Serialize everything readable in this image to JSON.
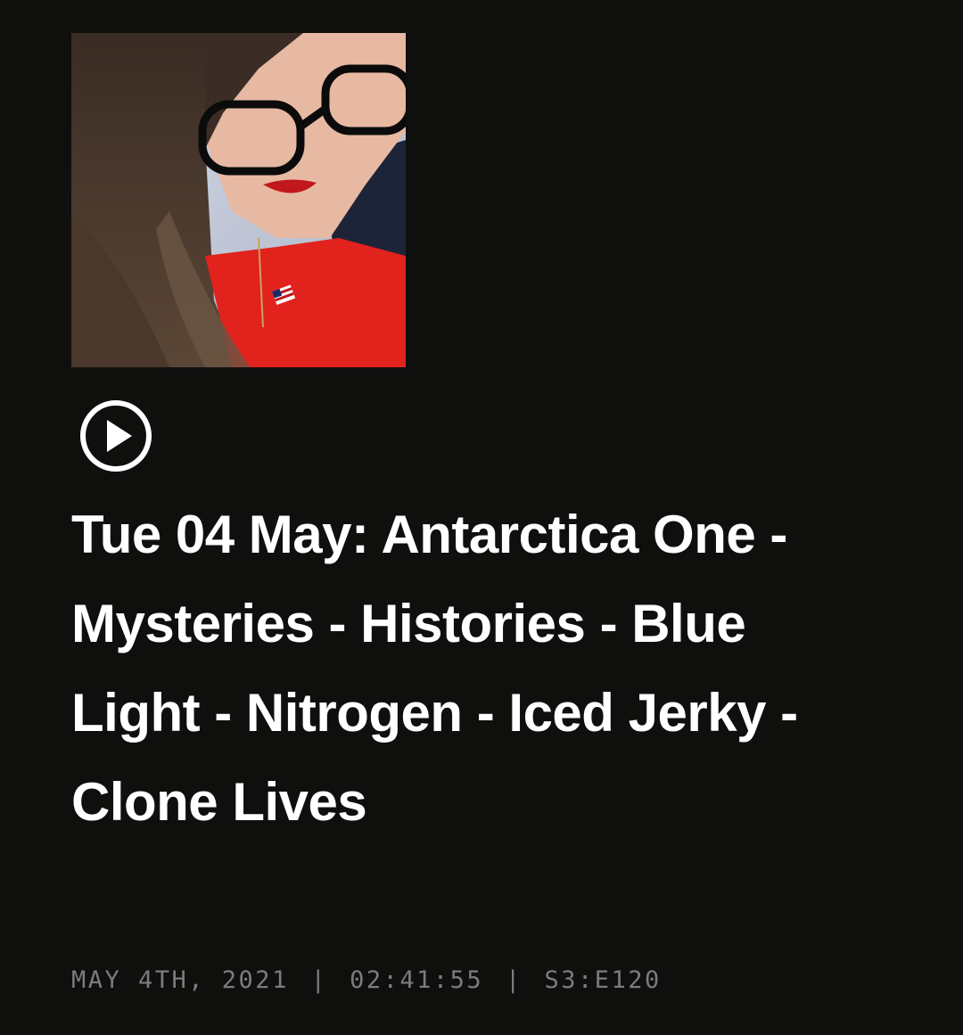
{
  "episode": {
    "cover_alt": "Podcast host portrait",
    "play_icon": "play-circle-icon",
    "title": "Tue 04 May: Antarctica One - Mysteries - Histories - Blue Light - Nitrogen - Iced Jerky - Clone Lives",
    "date": "MAY 4TH, 2021",
    "separator": "|",
    "duration": "02:41:55",
    "episode_code": "S3:E120"
  },
  "colors": {
    "background": "#0f0f0d",
    "title": "#ffffff",
    "meta": "#7c7c7c"
  }
}
